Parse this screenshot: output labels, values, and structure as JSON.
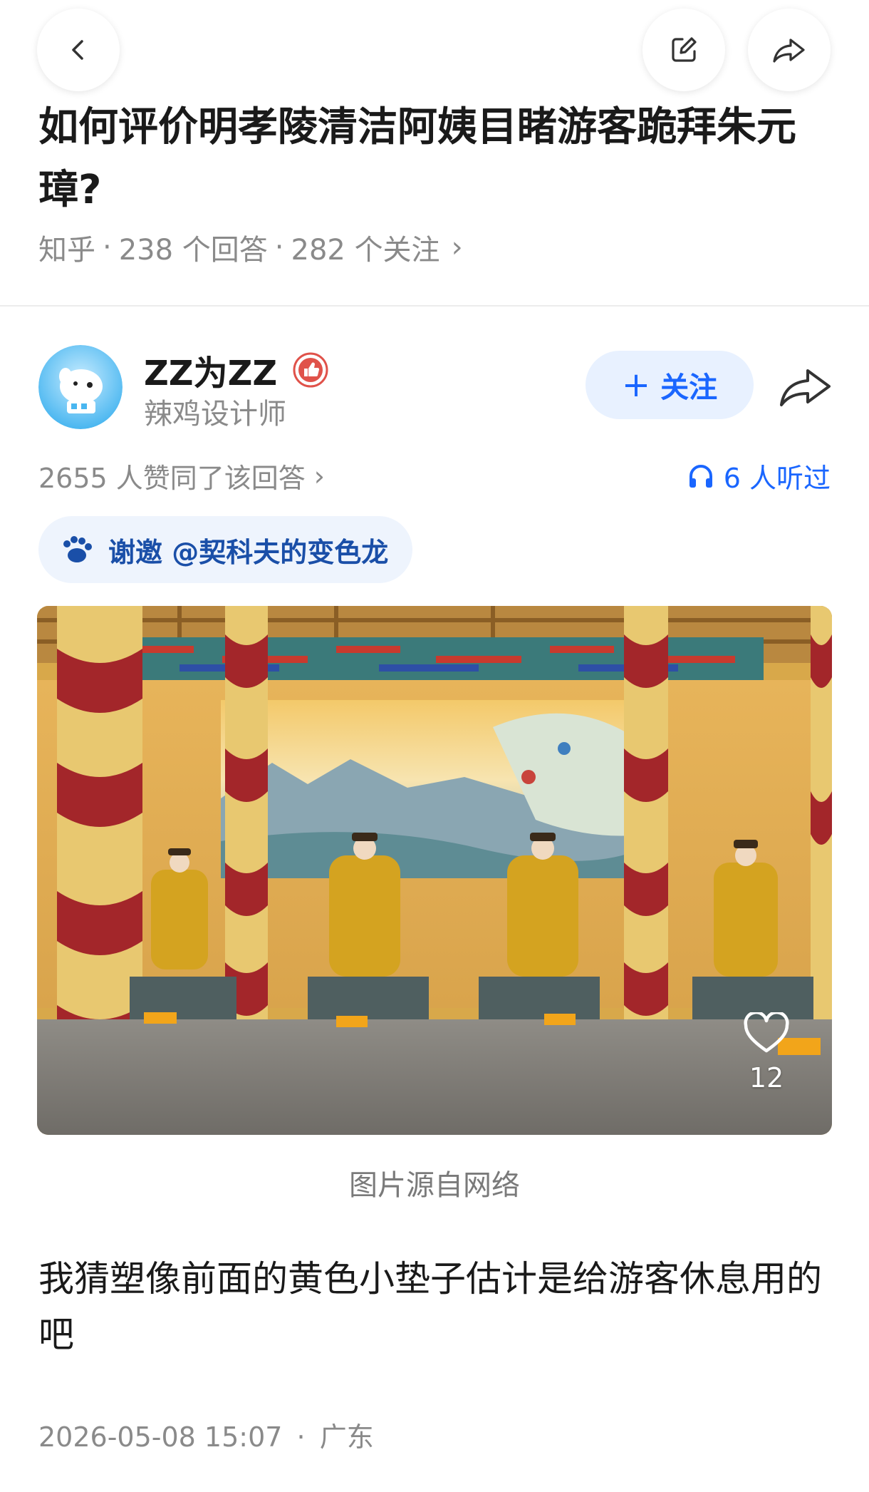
{
  "question": {
    "title": "如何评价明孝陵清洁阿姨目睹游客跪拜朱元璋?",
    "source": "知乎",
    "answers": "238 个回答",
    "follows": "282 个关注",
    "dot": "·",
    "arrow": "›"
  },
  "author": {
    "name": "ZZ为ZZ",
    "subtitle": "辣鸡设计师",
    "follow_plus": "+",
    "follow_label": "关注"
  },
  "stats": {
    "upvotes": "2655 人赞同了该回答",
    "arrow": "›",
    "listened": "6 人听过"
  },
  "invite": {
    "label": "谢邀 @契科夫的变色龙"
  },
  "photo": {
    "like_count": "12",
    "caption": "图片源自网络"
  },
  "answer": {
    "text": "我猜塑像前面的黄色小垫子估计是给游客休息用的吧",
    "timestamp": "2026-05-08 15:07",
    "location_sep": "·",
    "location": "广东"
  },
  "icons": {
    "back": "back-icon",
    "edit": "edit-icon",
    "share": "share-icon",
    "headphones": "headphones-icon",
    "heart": "heart-icon"
  },
  "colors": {
    "accent": "#1a66ff",
    "follow_bg": "#e8f1ff",
    "invite_bg": "#eef4fd",
    "meta_gray": "#8a8a8a"
  }
}
